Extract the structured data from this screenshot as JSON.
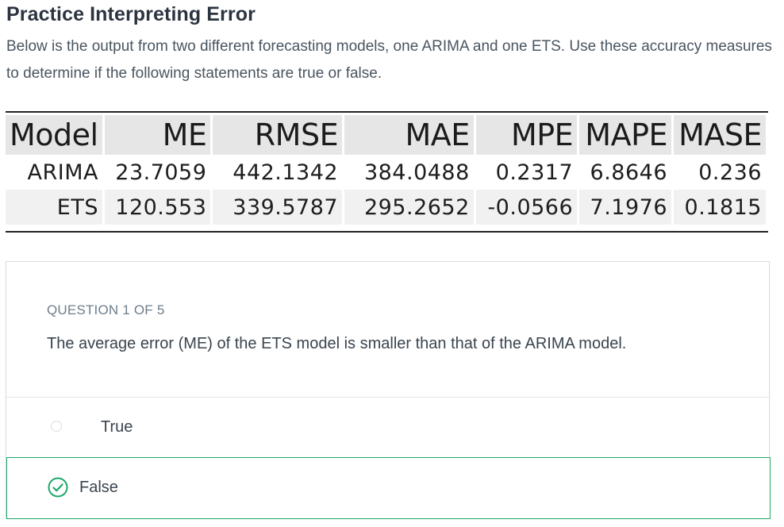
{
  "page": {
    "title": "Practice Interpreting Error",
    "intro": "Below is the output from two different forecasting models, one ARIMA and one ETS. Use these accuracy measures to determine if the following statements are true or false."
  },
  "table": {
    "headers": [
      "Model",
      "ME",
      "RMSE",
      "MAE",
      "MPE",
      "MAPE",
      "MASE"
    ],
    "rows": [
      [
        "ARIMA",
        "23.7059",
        "442.1342",
        "384.0488",
        "0.2317",
        "6.8646",
        "0.236"
      ],
      [
        "ETS",
        "120.553",
        "339.5787",
        "295.2652",
        "-0.0566",
        "7.1976",
        "0.1815"
      ]
    ]
  },
  "question": {
    "counter": "QUESTION 1 OF 5",
    "text": "The average error (ME) of the ETS model is smaller than that of the ARIMA model.",
    "options": [
      {
        "label": "True",
        "selected": false,
        "icon": "radio-empty-icon"
      },
      {
        "label": "False",
        "selected": true,
        "icon": "check-circle-icon"
      }
    ],
    "correct_color": "#1fa86b"
  }
}
